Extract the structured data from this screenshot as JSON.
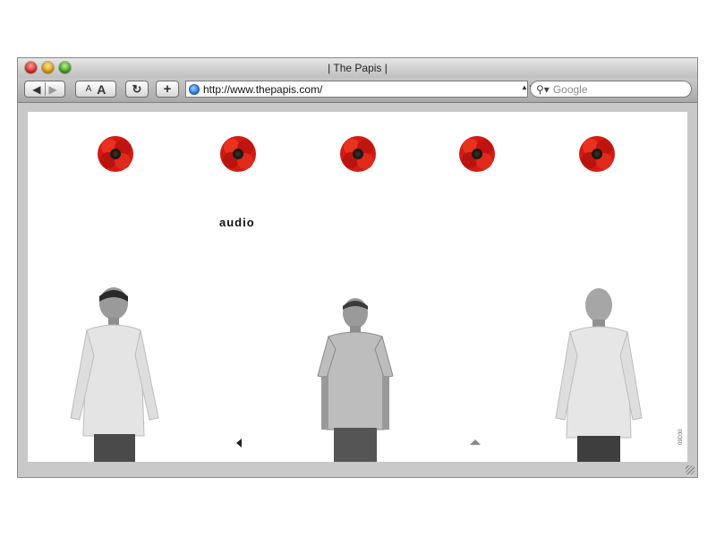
{
  "window": {
    "title": "| The Papis |"
  },
  "toolbar": {
    "back_icon": "back-arrow-icon",
    "forward_icon": "forward-arrow-icon",
    "font_smaller_label": "A",
    "font_larger_label": "A",
    "reload_icon": "reload-icon",
    "add_bookmark_label": "+",
    "url": "http://www.thepapis.com/",
    "search_placeholder": "Google"
  },
  "page": {
    "poppies": [
      "poppy-1",
      "poppy-2",
      "poppy-3",
      "poppy-4",
      "poppy-5"
    ],
    "nav_label": "audio",
    "credit_text": "09D30",
    "colors": {
      "poppy_red": "#d41a12",
      "poppy_center": "#1a1a1a",
      "accent_blue": "#1f6fd0"
    }
  }
}
